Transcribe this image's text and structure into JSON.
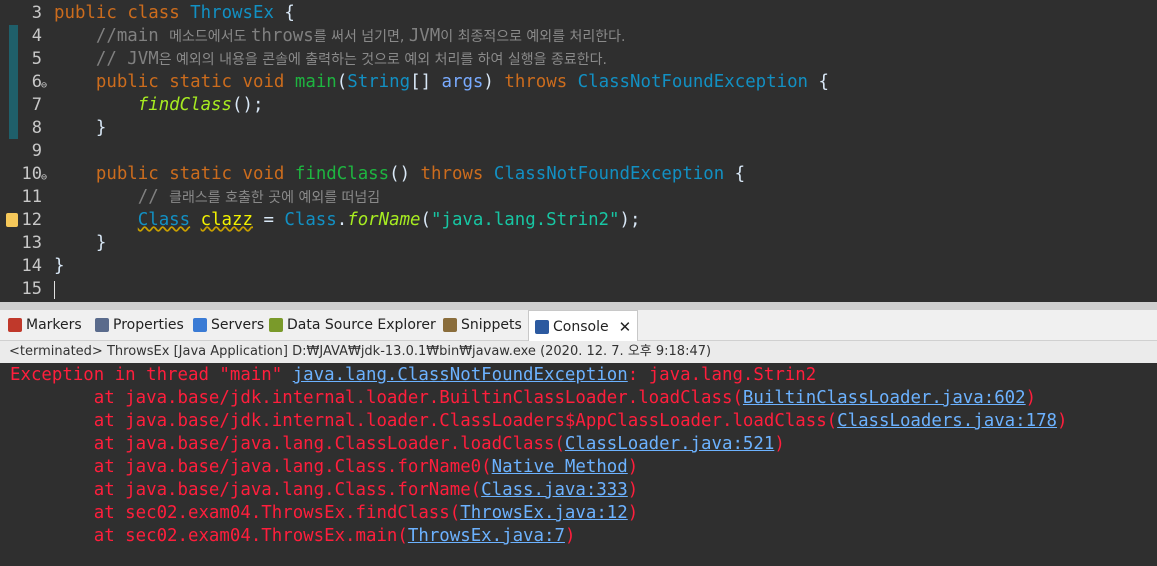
{
  "editor": {
    "lines": [
      {
        "num": "3",
        "parts": [
          {
            "t": "public",
            "c": "kw"
          },
          {
            "t": " "
          },
          {
            "t": "class",
            "c": "kw"
          },
          {
            "t": " "
          },
          {
            "t": "ThrowsEx",
            "c": "cls"
          },
          {
            "t": " {"
          }
        ]
      },
      {
        "num": "4",
        "parts": [
          {
            "t": "    //main ",
            "c": "cm"
          },
          {
            "t": "메소드에서도 ",
            "c": "cmk"
          },
          {
            "t": "throws",
            "c": "cm"
          },
          {
            "t": "를 써서 넘기면, ",
            "c": "cmk"
          },
          {
            "t": "JVM",
            "c": "cm"
          },
          {
            "t": "이 최종적으로 예외를 처리한다.",
            "c": "cmk"
          }
        ]
      },
      {
        "num": "5",
        "parts": [
          {
            "t": "    // JVM",
            "c": "cm"
          },
          {
            "t": "은 예외의 내용을 콘솔에 출력하는 것으로 예외 처리를 하여 실행을 종료한다.",
            "c": "cmk"
          }
        ]
      },
      {
        "num": "6",
        "fold": true,
        "parts": [
          {
            "t": "    "
          },
          {
            "t": "public",
            "c": "kw"
          },
          {
            "t": " "
          },
          {
            "t": "static",
            "c": "kw"
          },
          {
            "t": " "
          },
          {
            "t": "void",
            "c": "kw"
          },
          {
            "t": " "
          },
          {
            "t": "main",
            "c": "mth"
          },
          {
            "t": "("
          },
          {
            "t": "String",
            "c": "cls"
          },
          {
            "t": "[] "
          },
          {
            "t": "args",
            "c": "par"
          },
          {
            "t": ") "
          },
          {
            "t": "throws",
            "c": "kw"
          },
          {
            "t": " "
          },
          {
            "t": "ClassNotFoundException",
            "c": "cls"
          },
          {
            "t": " {"
          }
        ]
      },
      {
        "num": "7",
        "parts": [
          {
            "t": "        "
          },
          {
            "t": "findClass",
            "c": "ital"
          },
          {
            "t": "();"
          }
        ]
      },
      {
        "num": "8",
        "parts": [
          {
            "t": "    }"
          }
        ]
      },
      {
        "num": "9",
        "parts": [
          {
            "t": ""
          }
        ]
      },
      {
        "num": "10",
        "fold": true,
        "parts": [
          {
            "t": "    "
          },
          {
            "t": "public",
            "c": "kw"
          },
          {
            "t": " "
          },
          {
            "t": "static",
            "c": "kw"
          },
          {
            "t": " "
          },
          {
            "t": "void",
            "c": "kw"
          },
          {
            "t": " "
          },
          {
            "t": "findClass",
            "c": "mth"
          },
          {
            "t": "() "
          },
          {
            "t": "throws",
            "c": "kw"
          },
          {
            "t": " "
          },
          {
            "t": "ClassNotFoundException",
            "c": "cls"
          },
          {
            "t": " {"
          }
        ]
      },
      {
        "num": "11",
        "parts": [
          {
            "t": "        // ",
            "c": "cm"
          },
          {
            "t": "클래스를 호출한 곳에 예외를 떠넘김",
            "c": "cmk"
          }
        ]
      },
      {
        "num": "12",
        "warn": true,
        "parts": [
          {
            "t": "        "
          },
          {
            "t": "Class",
            "c": "cls-warn"
          },
          {
            "t": " "
          },
          {
            "t": "clazz",
            "c": "var"
          },
          {
            "t": " = "
          },
          {
            "t": "Class",
            "c": "cls"
          },
          {
            "t": "."
          },
          {
            "t": "forName",
            "c": "ital"
          },
          {
            "t": "("
          },
          {
            "t": "\"java.lang.Strin2\"",
            "c": "str"
          },
          {
            "t": ");"
          }
        ]
      },
      {
        "num": "13",
        "parts": [
          {
            "t": "    }"
          }
        ]
      },
      {
        "num": "14",
        "parts": [
          {
            "t": "}"
          }
        ]
      },
      {
        "num": "15",
        "caret": true,
        "parts": [
          {
            "t": ""
          }
        ]
      }
    ]
  },
  "tabs": [
    {
      "label": "Markers",
      "icon": "markers-icon",
      "color": "#c0392b"
    },
    {
      "label": "Properties",
      "icon": "properties-icon",
      "color": "#5a6b8c"
    },
    {
      "label": "Servers",
      "icon": "servers-icon",
      "color": "#3a7bd5"
    },
    {
      "label": "Data Source Explorer",
      "icon": "data-source-icon",
      "color": "#7a9a2a"
    },
    {
      "label": "Snippets",
      "icon": "snippets-icon",
      "color": "#8a6d3b"
    },
    {
      "label": "Console",
      "icon": "console-icon",
      "color": "#2c5aa0",
      "active": true
    }
  ],
  "console": {
    "status": "<terminated> ThrowsEx [Java Application] D:₩JAVA₩jdk-13.0.1₩bin₩javaw.exe (2020. 12. 7. 오후 9:18:47)",
    "lines": [
      [
        {
          "t": "Exception in thread \"main\" "
        },
        {
          "t": "java.lang.ClassNotFoundException",
          "l": true
        },
        {
          "t": ": java.lang.Strin2"
        }
      ],
      [
        {
          "t": "\tat java.base/jdk.internal.loader.BuiltinClassLoader.loadClass("
        },
        {
          "t": "BuiltinClassLoader.java:602",
          "l": true
        },
        {
          "t": ")"
        }
      ],
      [
        {
          "t": "\tat java.base/jdk.internal.loader.ClassLoaders$AppClassLoader.loadClass("
        },
        {
          "t": "ClassLoaders.java:178",
          "l": true
        },
        {
          "t": ")"
        }
      ],
      [
        {
          "t": "\tat java.base/java.lang.ClassLoader.loadClass("
        },
        {
          "t": "ClassLoader.java:521",
          "l": true
        },
        {
          "t": ")"
        }
      ],
      [
        {
          "t": "\tat java.base/java.lang.Class.forName0("
        },
        {
          "t": "Native Method",
          "l": true
        },
        {
          "t": ")"
        }
      ],
      [
        {
          "t": "\tat java.base/java.lang.Class.forName("
        },
        {
          "t": "Class.java:333",
          "l": true
        },
        {
          "t": ")"
        }
      ],
      [
        {
          "t": "\tat sec02.exam04.ThrowsEx.findClass("
        },
        {
          "t": "ThrowsEx.java:12",
          "l": true
        },
        {
          "t": ")"
        }
      ],
      [
        {
          "t": "\tat sec02.exam04.ThrowsEx.main("
        },
        {
          "t": "ThrowsEx.java:7",
          "l": true
        },
        {
          "t": ")"
        }
      ]
    ]
  }
}
